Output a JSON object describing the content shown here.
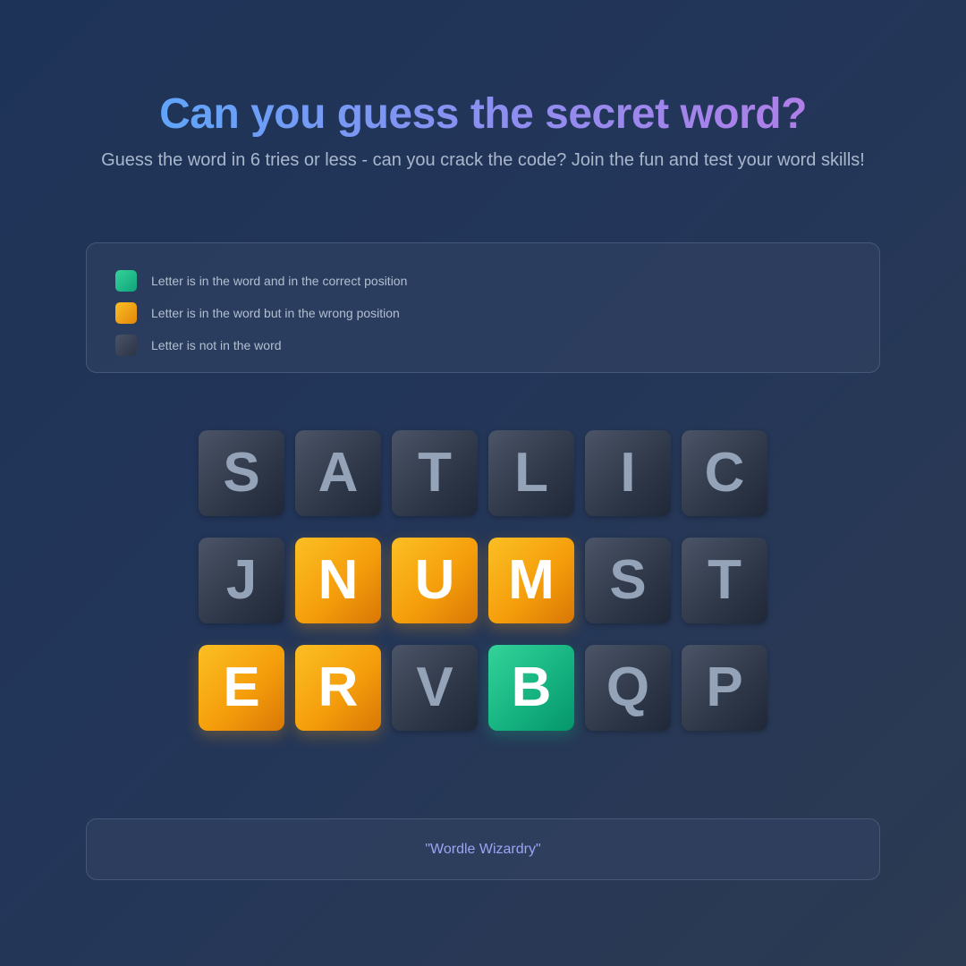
{
  "header": {
    "title": "Can you guess the secret word?",
    "subtitle": "Guess the word in 6 tries or less - can you crack the code? Join the fun and test your word skills!"
  },
  "legend": {
    "items": [
      {
        "state": "correct",
        "label": "Letter is in the word and in the correct position"
      },
      {
        "state": "present",
        "label": "Letter is in the word but in the wrong position"
      },
      {
        "state": "absent",
        "label": "Letter is not in the word"
      }
    ]
  },
  "board": {
    "rows": [
      [
        {
          "letter": "S",
          "state": "absent"
        },
        {
          "letter": "A",
          "state": "absent"
        },
        {
          "letter": "T",
          "state": "absent"
        },
        {
          "letter": "L",
          "state": "absent"
        },
        {
          "letter": "I",
          "state": "absent"
        },
        {
          "letter": "C",
          "state": "absent"
        }
      ],
      [
        {
          "letter": "J",
          "state": "absent"
        },
        {
          "letter": "N",
          "state": "present"
        },
        {
          "letter": "U",
          "state": "present"
        },
        {
          "letter": "M",
          "state": "present"
        },
        {
          "letter": "S",
          "state": "absent"
        },
        {
          "letter": "T",
          "state": "absent"
        }
      ],
      [
        {
          "letter": "E",
          "state": "present"
        },
        {
          "letter": "R",
          "state": "present"
        },
        {
          "letter": "V",
          "state": "absent"
        },
        {
          "letter": "B",
          "state": "correct"
        },
        {
          "letter": "Q",
          "state": "absent"
        },
        {
          "letter": "P",
          "state": "absent"
        }
      ]
    ]
  },
  "footer": {
    "text": "\"Wordle Wizardry\""
  },
  "colors": {
    "correct": "#10b981",
    "present": "#f59e0b",
    "absent": "#374151",
    "title_gradient_start": "#60a5fa",
    "title_gradient_end": "#b07ee8"
  }
}
